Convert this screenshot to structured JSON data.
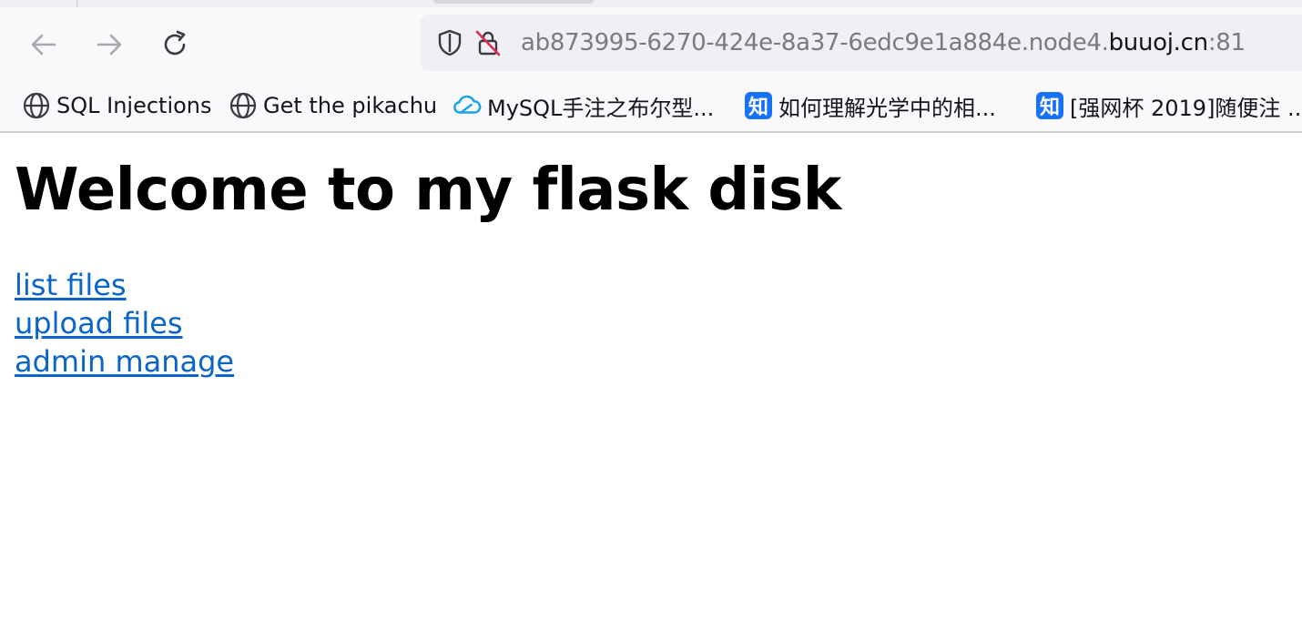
{
  "browser": {
    "url_prefix": "ab873995-6270-424e-8a37-6edc9e1a884e.node4.",
    "url_domain": "buuoj.cn",
    "url_suffix": ":81"
  },
  "bookmarks": [
    {
      "label": "SQL Injections",
      "icon": "globe-icon"
    },
    {
      "label": "Get the pikachu",
      "icon": "globe-icon"
    },
    {
      "label": "MySQL手注之布尔型...",
      "icon": "cloud-icon"
    },
    {
      "label": "如何理解光学中的相...",
      "icon": "zhihu-icon",
      "icon_text": "知"
    },
    {
      "label": "[强网杯 2019]随便注 ...",
      "icon": "zhihu-icon",
      "icon_text": "知"
    }
  ],
  "page": {
    "title": "Welcome to my flask disk",
    "links": [
      {
        "label": "list files"
      },
      {
        "label": "upload files"
      },
      {
        "label": "admin manage"
      }
    ]
  },
  "colors": {
    "link": "#0b64c8",
    "zhihu": "#1772f6",
    "cloud": "#1aa3e8",
    "lock_slash": "#e22850"
  }
}
